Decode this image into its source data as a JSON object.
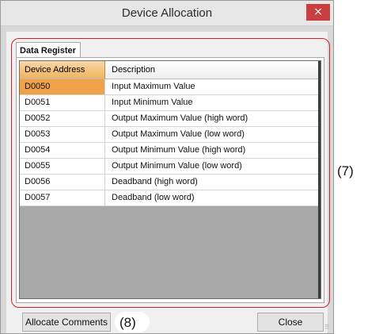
{
  "window": {
    "title": "Device Allocation",
    "close_glyph": "×"
  },
  "tab": {
    "label": "Data Register"
  },
  "grid": {
    "headers": {
      "address": "Device Address",
      "description": "Description"
    },
    "rows": [
      {
        "address": "D0050",
        "description": "Input Maximum Value",
        "selected": true
      },
      {
        "address": "D0051",
        "description": "Input Minimum Value"
      },
      {
        "address": "D0052",
        "description": "Output Maximum Value (high word)"
      },
      {
        "address": "D0053",
        "description": "Output Maximum Value (low word)"
      },
      {
        "address": "D0054",
        "description": "Output Minimum Value (high word)"
      },
      {
        "address": "D0055",
        "description": "Output Minimum Value (low word)"
      },
      {
        "address": "D0056",
        "description": "Deadband (high word)"
      },
      {
        "address": "D0057",
        "description": "Deadband (low word)"
      }
    ]
  },
  "buttons": {
    "allocate": "Allocate Comments",
    "close": "Close"
  },
  "annotations": {
    "seven": "(7)",
    "eight": "(8)"
  },
  "colors": {
    "selection": "#f0a24b",
    "close_button": "#c93e3e",
    "callout": "#d02020"
  }
}
